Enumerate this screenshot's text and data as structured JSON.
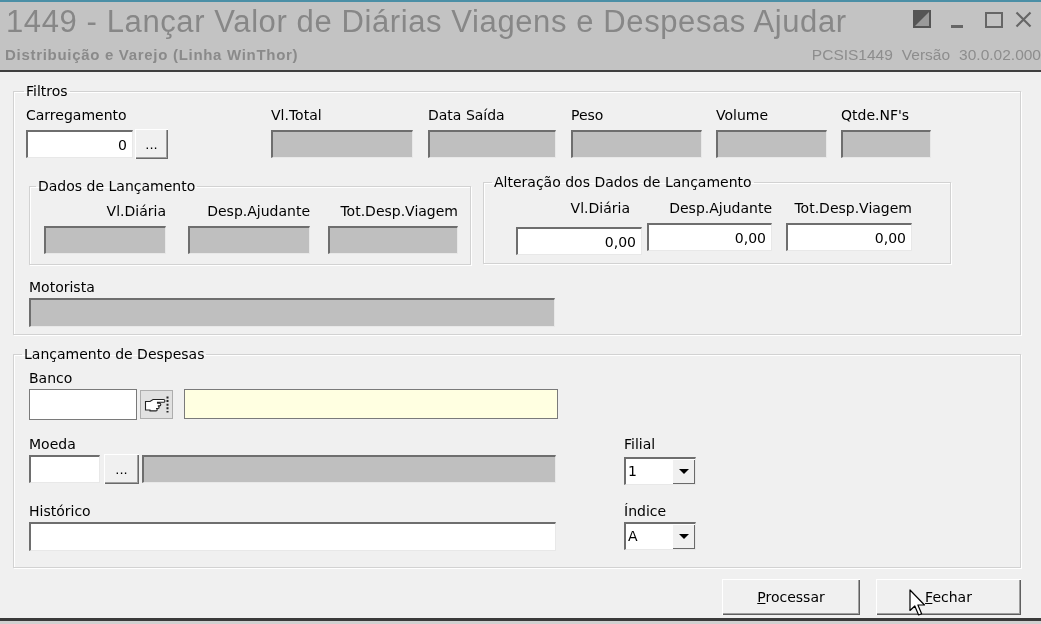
{
  "window": {
    "title": "1449 - Lançar Valor de Diárias Viagens e Despesas Ajudar",
    "subtitle": "Distribuição e Varejo (Linha WinThor)",
    "program": "PCSIS1449",
    "version_label": "Versão",
    "version": "30.0.02.000"
  },
  "filters": {
    "title": "Filtros",
    "load": {
      "label": "Carregamento",
      "value": "0",
      "button": "...",
      "disabled": false
    },
    "info_fields": [
      {
        "label": "Vl.Total",
        "disabled": true
      },
      {
        "label": "Data Saída",
        "disabled": true
      },
      {
        "label": "Peso",
        "disabled": true
      },
      {
        "label": "Volume",
        "disabled": true
      },
      {
        "label": "Qtde.NF's",
        "disabled": true
      }
    ],
    "posting_data": {
      "title": "Dados de Lançamento",
      "fields": [
        {
          "label": "Vl.Diária",
          "disabled": true
        },
        {
          "label": "Desp.Ajudante",
          "disabled": true
        },
        {
          "label": "Tot.Desp.Viagem",
          "disabled": true
        }
      ]
    },
    "posting_change": {
      "title": "Alteração dos Dados de Lançamento",
      "fields": [
        {
          "label": "Vl.Diária",
          "value": "0,00",
          "disabled": false
        },
        {
          "label": "Desp.Ajudante",
          "value": "0,00",
          "disabled": false
        },
        {
          "label": "Tot.Desp.Viagem",
          "value": "0,00",
          "disabled": false
        }
      ]
    },
    "driver": {
      "label": "Motorista",
      "disabled": true
    }
  },
  "expenses": {
    "title": "Lançamento de Despesas",
    "bank": {
      "label": "Banco",
      "disabled": false,
      "description": {
        "disabled": false,
        "highlighted": true
      }
    },
    "currency": {
      "label": "Moeda",
      "button": "...",
      "disabled": false,
      "description": {
        "disabled": true
      }
    },
    "history": {
      "label": "Histórico",
      "disabled": false
    },
    "branch": {
      "label": "Filial",
      "value": "1"
    },
    "index": {
      "label": "Índice",
      "value": "A"
    }
  },
  "buttons": [
    "Processar",
    "Fechar"
  ]
}
